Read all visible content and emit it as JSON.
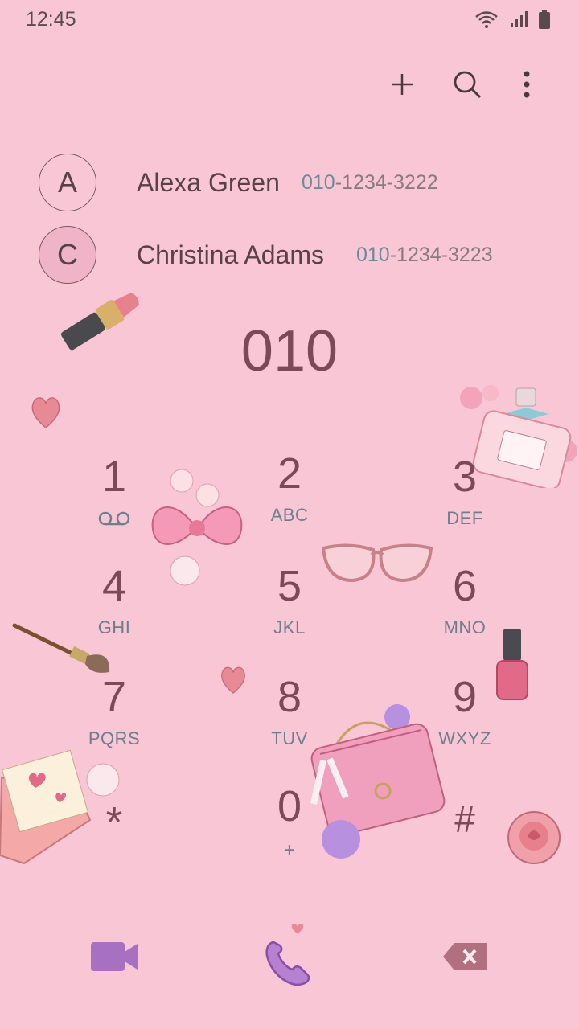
{
  "status": {
    "time": "12:45"
  },
  "toolbar": {
    "add_icon": "plus-icon",
    "search_icon": "search-icon",
    "more_icon": "more-vert-icon"
  },
  "contacts": [
    {
      "initial": "A",
      "name": "Alexa Green",
      "number_match": "010",
      "number_rest": "-1234-3222"
    },
    {
      "initial": "C",
      "name": "Christina Adams",
      "number_match": "010",
      "number_rest": "-1234-3223"
    }
  ],
  "dialer": {
    "entered": "010"
  },
  "keypad": [
    {
      "digit": "1",
      "letters": ""
    },
    {
      "digit": "2",
      "letters": "ABC"
    },
    {
      "digit": "3",
      "letters": "DEF"
    },
    {
      "digit": "4",
      "letters": "GHI"
    },
    {
      "digit": "5",
      "letters": "JKL"
    },
    {
      "digit": "6",
      "letters": "MNO"
    },
    {
      "digit": "7",
      "letters": "PQRS"
    },
    {
      "digit": "8",
      "letters": "TUV"
    },
    {
      "digit": "9",
      "letters": "WXYZ"
    },
    {
      "digit": "*",
      "letters": ""
    },
    {
      "digit": "0",
      "letters": "+"
    },
    {
      "digit": "#",
      "letters": ""
    }
  ],
  "colors": {
    "background": "#f9c6d6",
    "digit": "#7c4a56",
    "letters": "#6e7f8c",
    "accent_purple": "#a870c0"
  }
}
